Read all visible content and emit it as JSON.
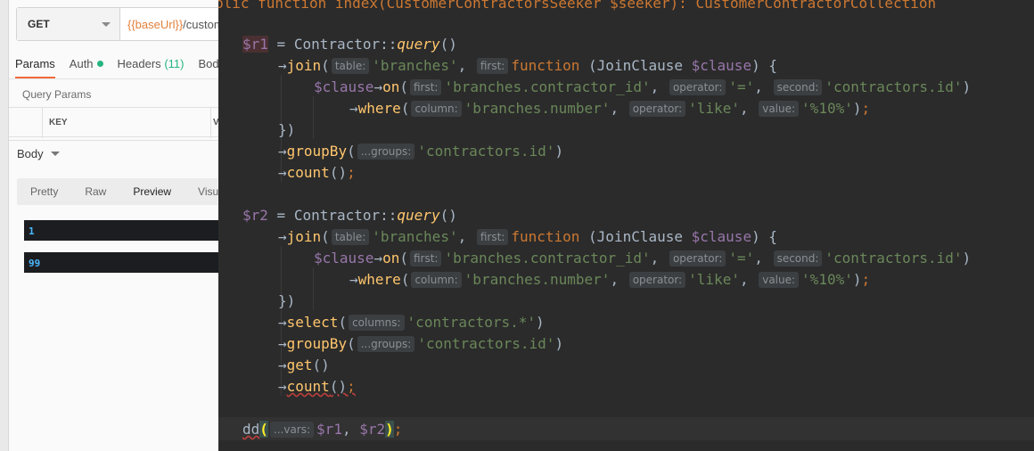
{
  "postman": {
    "method": "GET",
    "url_var": "{{baseUrl}}",
    "url_rest": "/custom",
    "tabs": [
      {
        "label": "Params"
      },
      {
        "label": "Auth"
      },
      {
        "label": "Headers",
        "count": "(11)"
      },
      {
        "label": "Bod"
      }
    ],
    "query_params_label": "Query Params",
    "table_key_header": "KEY",
    "table_value_header": "V",
    "body_label": "Body",
    "response_tabs": [
      "Pretty",
      "Raw",
      "Preview",
      "Visu"
    ],
    "response_selected": "Preview",
    "response_values": [
      "1",
      "99"
    ]
  },
  "editor": {
    "top_line": "blic function index(CustomerContractorsSeeker $seeker): CustomerContractorCollection",
    "hints": {
      "table": "table:",
      "first": "first:",
      "operator": "operator:",
      "second": "second:",
      "column": "column:",
      "value": "value:",
      "groups": "...groups:",
      "columns": "columns:",
      "vars": "...vars:"
    },
    "var_r1": "$r1",
    "var_r2": "$r2",
    "var_clause": "$clause",
    "class_name": "Contractor",
    "method_query": "query",
    "method_join": "join",
    "method_on": "on",
    "method_where": "where",
    "method_groupBy": "groupBy",
    "method_count": "count",
    "method_select": "select",
    "method_get": "get",
    "func_dd": "dd",
    "kw_function": "function",
    "type_joinclause": "JoinClause",
    "str_branches": "'branches'",
    "str_contractor_id": "'branches.contractor_id'",
    "str_eq": "'='",
    "str_contractors_id": "'contractors.id'",
    "str_number": "'branches.number'",
    "str_like": "'like'",
    "str_pct": "'%10%'",
    "str_contractors_star": "'contractors.*'"
  },
  "colors": {
    "editor_bg": "#2b2b2b",
    "keyword": "#cc7832",
    "string": "#6a8759",
    "variable": "#9876aa",
    "method": "#ffc66d",
    "postman_accent": "#f26b3a",
    "url_var": "#e2803b",
    "response_number": "#4ab8ff"
  }
}
